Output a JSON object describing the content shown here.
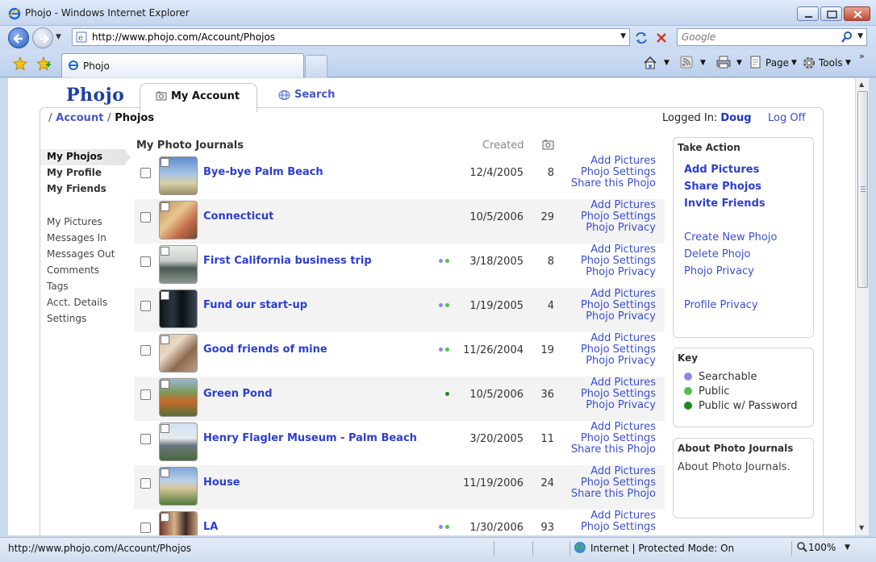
{
  "window": {
    "title": "Phojo - Windows Internet Explorer"
  },
  "address": {
    "url": "http://www.phojo.com/Account/Phojos",
    "search_placeholder": "Google"
  },
  "browser_tab": {
    "label": "Phojo"
  },
  "commands": {
    "page": "Page",
    "tools": "Tools"
  },
  "site": {
    "logo": "Phojo",
    "tab_account": "My Account",
    "tab_search": "Search"
  },
  "breadcrumb": {
    "account": "Account",
    "current": "Phojos"
  },
  "session": {
    "logged_in_label": "Logged In:",
    "user": "Doug",
    "logoff": "Log Off"
  },
  "leftnav": {
    "primary": [
      "My Phojos",
      "My Profile",
      "My Friends"
    ],
    "secondary": [
      "My Pictures",
      "Messages In",
      "Messages Out",
      "Comments",
      "Tags",
      "Acct. Details",
      "Settings"
    ]
  },
  "list": {
    "heading": "My Photo Journals",
    "created_label": "Created",
    "rows": [
      {
        "title": "Bye-bye Palm Beach",
        "date": "12/4/2005",
        "count": "8",
        "dots": [],
        "actions": [
          "Add Pictures",
          "Phojo Settings",
          "Share this Phojo"
        ]
      },
      {
        "title": "Connecticut",
        "date": "10/5/2006",
        "count": "29",
        "dots": [],
        "actions": [
          "Add Pictures",
          "Phojo Settings",
          "Phojo Privacy"
        ]
      },
      {
        "title": "First California business trip",
        "date": "3/18/2005",
        "count": "8",
        "dots": [
          "searchable",
          "public"
        ],
        "actions": [
          "Add Pictures",
          "Phojo Settings",
          "Phojo Privacy"
        ]
      },
      {
        "title": "Fund our start-up",
        "date": "1/19/2005",
        "count": "4",
        "dots": [
          "searchable",
          "public"
        ],
        "actions": [
          "Add Pictures",
          "Phojo Settings",
          "Phojo Privacy"
        ]
      },
      {
        "title": "Good friends of mine",
        "date": "11/26/2004",
        "count": "19",
        "dots": [
          "searchable",
          "public"
        ],
        "actions": [
          "Add Pictures",
          "Phojo Settings",
          "Phojo Privacy"
        ]
      },
      {
        "title": "Green Pond",
        "date": "10/5/2006",
        "count": "36",
        "dots": [
          "password"
        ],
        "actions": [
          "Add Pictures",
          "Phojo Settings",
          "Phojo Privacy"
        ]
      },
      {
        "title": "Henry Flagler Museum - Palm Beach",
        "date": "3/20/2005",
        "count": "11",
        "dots": [],
        "actions": [
          "Add Pictures",
          "Phojo Settings",
          "Share this Phojo"
        ]
      },
      {
        "title": "House",
        "date": "11/19/2006",
        "count": "24",
        "dots": [],
        "actions": [
          "Add Pictures",
          "Phojo Settings",
          "Share this Phojo"
        ]
      },
      {
        "title": "LA",
        "date": "1/30/2006",
        "count": "93",
        "dots": [
          "searchable",
          "public"
        ],
        "actions": [
          "Add Pictures",
          "Phojo Settings",
          ""
        ]
      }
    ]
  },
  "take_action": {
    "heading": "Take Action",
    "primary": [
      "Add Pictures",
      "Share Phojos",
      "Invite Friends"
    ],
    "secondary": [
      "Create New Phojo",
      "Delete Phojo",
      "Phojo Privacy"
    ],
    "tertiary": [
      "Profile Privacy"
    ]
  },
  "key": {
    "heading": "Key",
    "items": [
      {
        "label": "Searchable",
        "color": "#8a8ae8"
      },
      {
        "label": "Public",
        "color": "#4cc24c"
      },
      {
        "label": "Public w/ Password",
        "color": "#1e8a1e"
      }
    ]
  },
  "about": {
    "heading": "About Photo Journals",
    "text": "About Photo Journals."
  },
  "status": {
    "url": "http://www.phojo.com/Account/Phojos",
    "zone": "Internet | Protected Mode: On",
    "zoom": "100%"
  },
  "colors": {
    "link": "#2c3fd0",
    "searchable": "#8a8ae8",
    "public": "#4cc24c",
    "password": "#1e8a1e"
  }
}
